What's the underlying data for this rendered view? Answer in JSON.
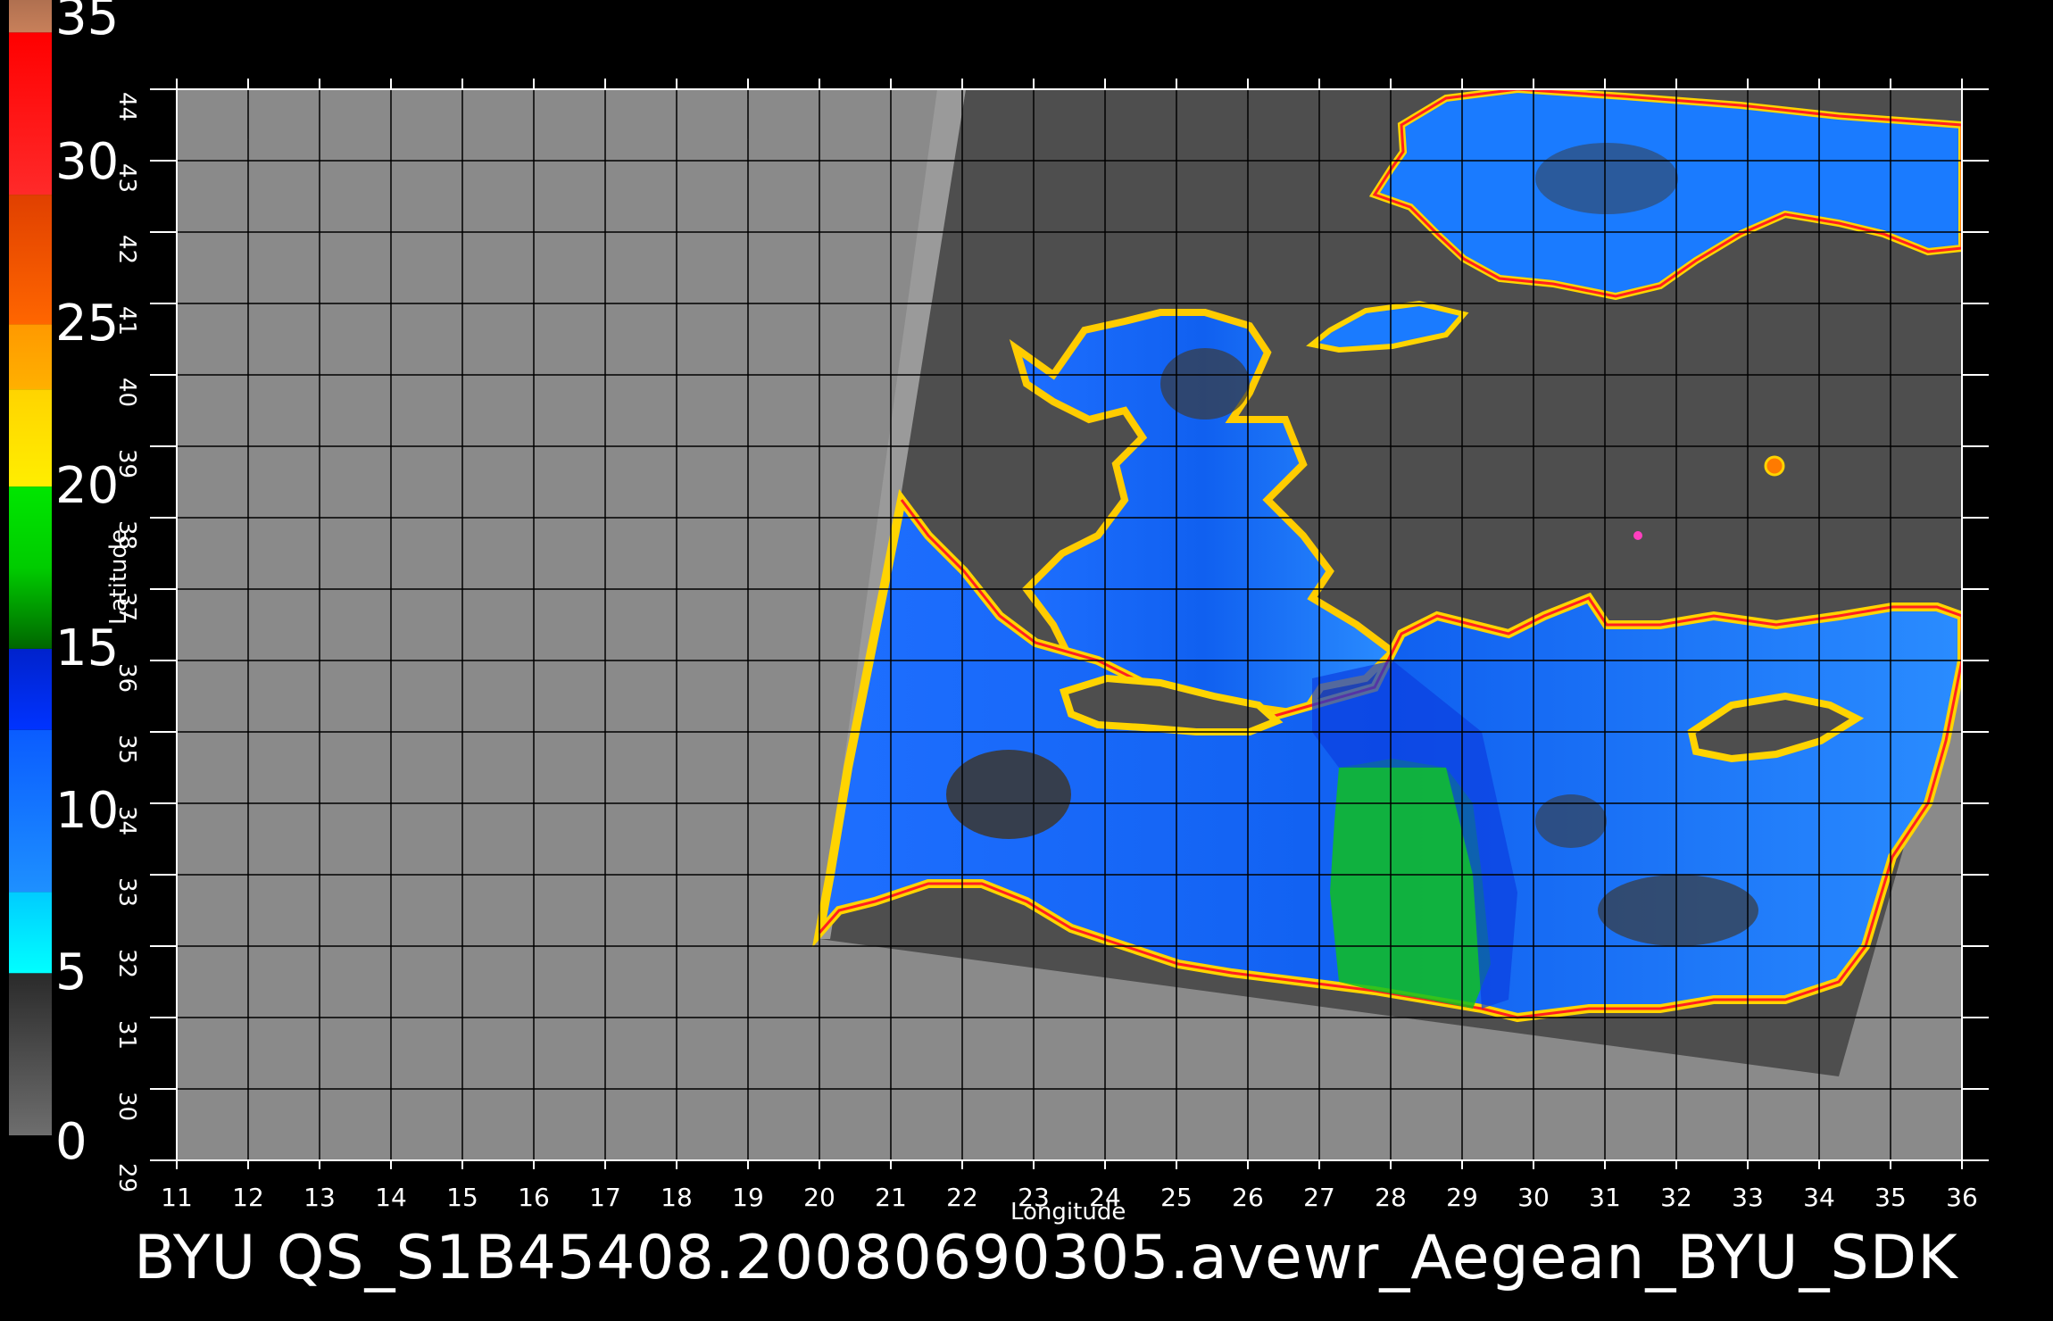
{
  "colorbar": {
    "labels": [
      "0",
      "5",
      "10",
      "15",
      "20",
      "25",
      "30",
      "35"
    ],
    "values": [
      0,
      5,
      10,
      15,
      20,
      25,
      30,
      35
    ],
    "segments": [
      {
        "from": 0,
        "to": 5,
        "color": "#6e6e6e",
        "color2": "#2a2a2a"
      },
      {
        "from": 5,
        "to": 7.5,
        "color": "#00ffff",
        "color2": "#00ccff"
      },
      {
        "from": 7.5,
        "to": 12.5,
        "color": "#1e90ff",
        "color2": "#0a5cff"
      },
      {
        "from": 12.5,
        "to": 15,
        "color": "#0033ff",
        "color2": "#0022cc"
      },
      {
        "from": 15,
        "to": 17.5,
        "color": "#006600",
        "color2": "#00cc00"
      },
      {
        "from": 17.5,
        "to": 20,
        "color": "#00cc00",
        "color2": "#00e600"
      },
      {
        "from": 20,
        "to": 23,
        "color": "#ffee00",
        "color2": "#ffd400"
      },
      {
        "from": 23,
        "to": 25,
        "color": "#ffb000",
        "color2": "#ff9900"
      },
      {
        "from": 25,
        "to": 29,
        "color": "#ff6600",
        "color2": "#e04000"
      },
      {
        "from": 29,
        "to": 34,
        "color": "#ff2a2a",
        "color2": "#ff0000"
      },
      {
        "from": 34,
        "to": 35,
        "color": "#c8805a",
        "color2": "#b07050"
      }
    ]
  },
  "axes": {
    "xlabel": "Longitude",
    "ylabel": "Latitude",
    "xticks": [
      "11",
      "12",
      "13",
      "14",
      "15",
      "16",
      "17",
      "18",
      "19",
      "20",
      "21",
      "22",
      "23",
      "24",
      "25",
      "26",
      "27",
      "28",
      "29",
      "30",
      "31",
      "32",
      "33",
      "34",
      "35",
      "36"
    ],
    "yticks": [
      "29",
      "30",
      "31",
      "32",
      "33",
      "34",
      "35",
      "36",
      "37",
      "38",
      "39",
      "40",
      "41",
      "42",
      "43",
      "44"
    ],
    "xrange": [
      11,
      36
    ],
    "yrange": [
      29,
      44
    ]
  },
  "colors": {
    "background": "#000000",
    "plot_bg": "#8a8a8a",
    "swath": "#4e4e4e",
    "grid": "#000000"
  },
  "footer": {
    "text": "BYU  QS_S1B45408.20080690305.avewr_Aegean_BYU_SDK"
  }
}
